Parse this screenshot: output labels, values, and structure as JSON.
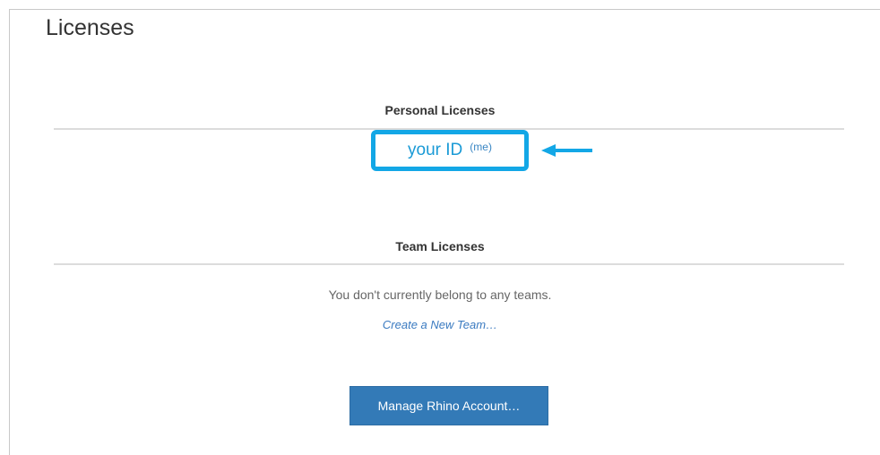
{
  "page": {
    "title": "Licenses"
  },
  "personal": {
    "heading": "Personal Licenses",
    "user_id": "your ID",
    "me_tag": "(me)"
  },
  "team": {
    "heading": "Team Licenses",
    "empty_message": "You don't currently belong to any teams.",
    "create_link": "Create a New Team…"
  },
  "actions": {
    "manage_account": "Manage Rhino Account…"
  },
  "colors": {
    "highlight": "#13a7e6",
    "link": "#3a7ac0",
    "primary_button": "#337ab7"
  }
}
